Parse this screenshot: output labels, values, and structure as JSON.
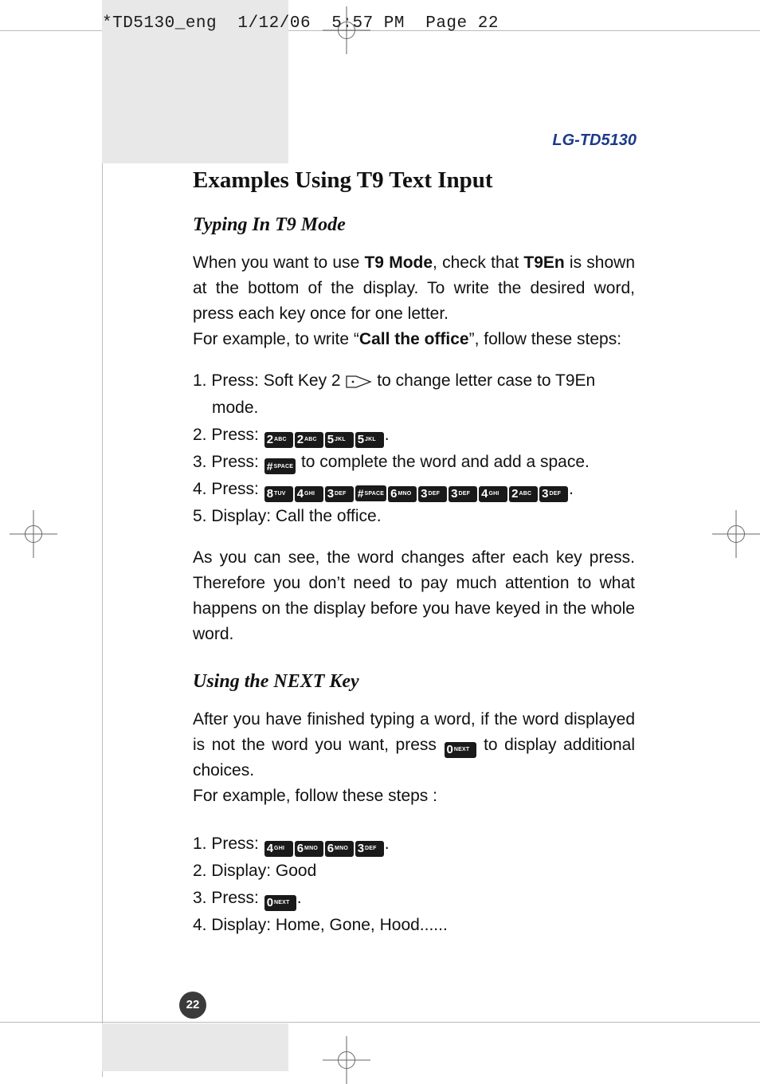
{
  "slug": {
    "file": "*TD5130_eng",
    "date": "1/12/06",
    "time": "5:57 PM",
    "page": "Page 22"
  },
  "model": "LG-TD5130",
  "heading": "Examples Using T9 Text Input",
  "section1": {
    "title": "Typing In T9 Mode",
    "para1_a": "When you want to use ",
    "para1_b": "T9 Mode",
    "para1_c": ", check that ",
    "para1_d": "T9En",
    "para1_e": " is shown at the bottom of the display. To write the desired word, press each key once for one letter.",
    "para2_a": "For example, to write “",
    "para2_b": "Call the office",
    "para2_c": "”, follow these steps:",
    "step1_a": "1. Press: Soft Key 2 ",
    "step1_b": " to change letter case to T9En",
    "step1_c": "mode.",
    "step2": "2. Press: ",
    "step2_keys": [
      "2ABC",
      "2ABC",
      "5JKL",
      "5JKL"
    ],
    "step2_end": ".",
    "step3_a": "3. Press: ",
    "step3_key": "#SPACE",
    "step3_b": " to complete the word and add a space.",
    "step4": "4. Press: ",
    "step4_keys": [
      "8TUV",
      "4GHI",
      "3DEF",
      "#SPACE",
      "6MNO",
      "3DEF",
      "3DEF",
      "4GHI",
      "2ABC",
      "3DEF"
    ],
    "step4_end": ".",
    "step5": "5. Display: Call the office.",
    "para3": "As you can see, the word changes after each key press. Therefore you don’t need to pay much attention to what happens on the display before you have keyed in the whole word."
  },
  "section2": {
    "title": "Using the NEXT Key",
    "para1_a": "After you have finished typing a word, if the word displayed is not the word you want, press ",
    "para1_key": "0NEXT",
    "para1_b": " to display additional choices.",
    "para2": "For example, follow these steps :",
    "step1": "1. Press: ",
    "step1_keys": [
      "4GHI",
      "6MNO",
      "6MNO",
      "3DEF"
    ],
    "step1_end": ".",
    "step2": "2. Display: Good",
    "step3_a": "3. Press: ",
    "step3_key": "0NEXT",
    "step3_b": ".",
    "step4": "4. Display: Home, Gone, Hood......"
  },
  "pagenum": "22"
}
